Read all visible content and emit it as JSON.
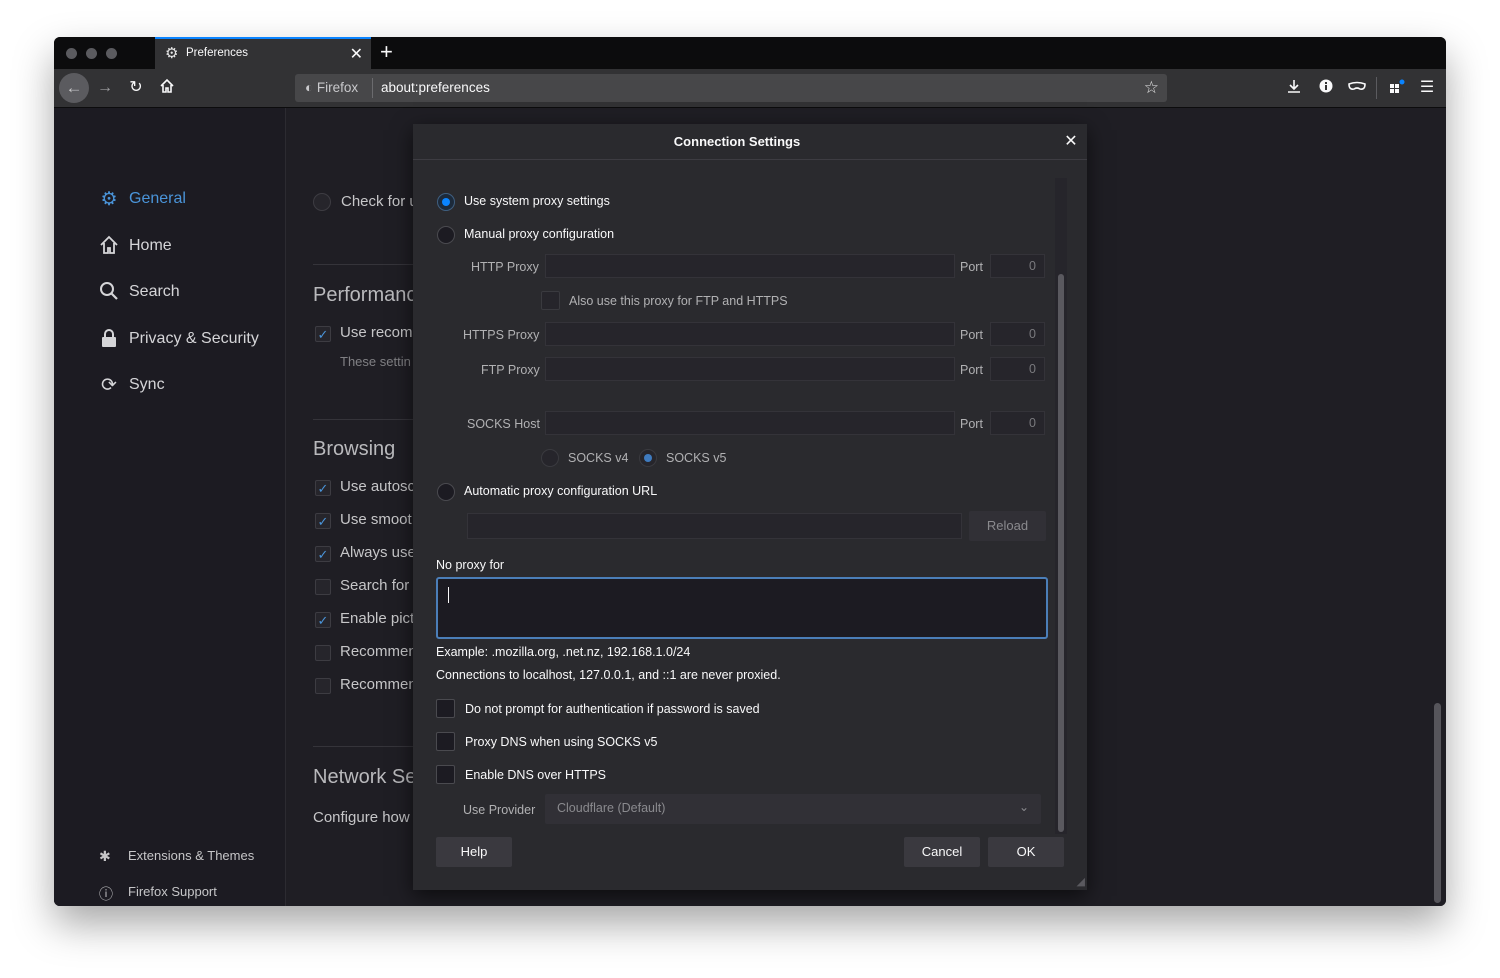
{
  "tab": {
    "title": "Preferences",
    "close": "✕",
    "new_tab": "+"
  },
  "urlbar": {
    "identity": "Firefox",
    "url": "about:preferences"
  },
  "sidebar": {
    "categories": [
      {
        "label": "General",
        "icon": "gear-icon"
      },
      {
        "label": "Home",
        "icon": "home-icon"
      },
      {
        "label": "Search",
        "icon": "search-icon"
      },
      {
        "label": "Privacy & Security",
        "icon": "lock-icon"
      },
      {
        "label": "Sync",
        "icon": "sync-icon"
      }
    ],
    "footer": [
      {
        "label": "Extensions & Themes",
        "icon": "puzzle-icon"
      },
      {
        "label": "Firefox Support",
        "icon": "help-icon"
      }
    ]
  },
  "background": {
    "check_for": "Check for u",
    "performance_heading": "Performance",
    "use_recommended": "Use recomm",
    "these_settings": "These settin",
    "browsing_heading": "Browsing",
    "browsing_items": [
      "Use autosc",
      "Use smoot",
      "Always use",
      "Search for",
      "Enable pict",
      "Recommen",
      "Recommen"
    ],
    "network_heading": "Network Se",
    "configure_how": "Configure how"
  },
  "dialog": {
    "title": "Connection Settings",
    "close": "✕",
    "use_system_proxy": "Use system proxy settings",
    "manual_proxy": "Manual proxy configuration",
    "http_proxy_label": "HTTP Proxy",
    "port_label": "Port",
    "http_port": "0",
    "also_use_proxy": "Also use this proxy for FTP and HTTPS",
    "https_proxy_label": "HTTPS Proxy",
    "https_port": "0",
    "ftp_proxy_label": "FTP Proxy",
    "ftp_port": "0",
    "socks_host_label": "SOCKS Host",
    "socks_port": "0",
    "socks_v4": "SOCKS v4",
    "socks_v5": "SOCKS v5",
    "auto_proxy_url": "Automatic proxy configuration URL",
    "reload": "Reload",
    "no_proxy_for": "No proxy for",
    "example": "Example: .mozilla.org, .net.nz, 192.168.1.0/24",
    "localhost_note": "Connections to localhost, 127.0.0.1, and ::1 are never proxied.",
    "no_auth_prompt": "Do not prompt for authentication if password is saved",
    "proxy_dns": "Proxy DNS when using SOCKS v5",
    "enable_doh": "Enable DNS over HTTPS",
    "use_provider_label": "Use Provider",
    "provider_value": "Cloudflare (Default)",
    "help": "Help",
    "cancel": "Cancel",
    "ok": "OK"
  },
  "colors": {
    "accent": "#0a84ff",
    "active_category": "#4a94d9",
    "dialog_bg": "#2a2a2e",
    "page_bg": "#1f1e24"
  }
}
